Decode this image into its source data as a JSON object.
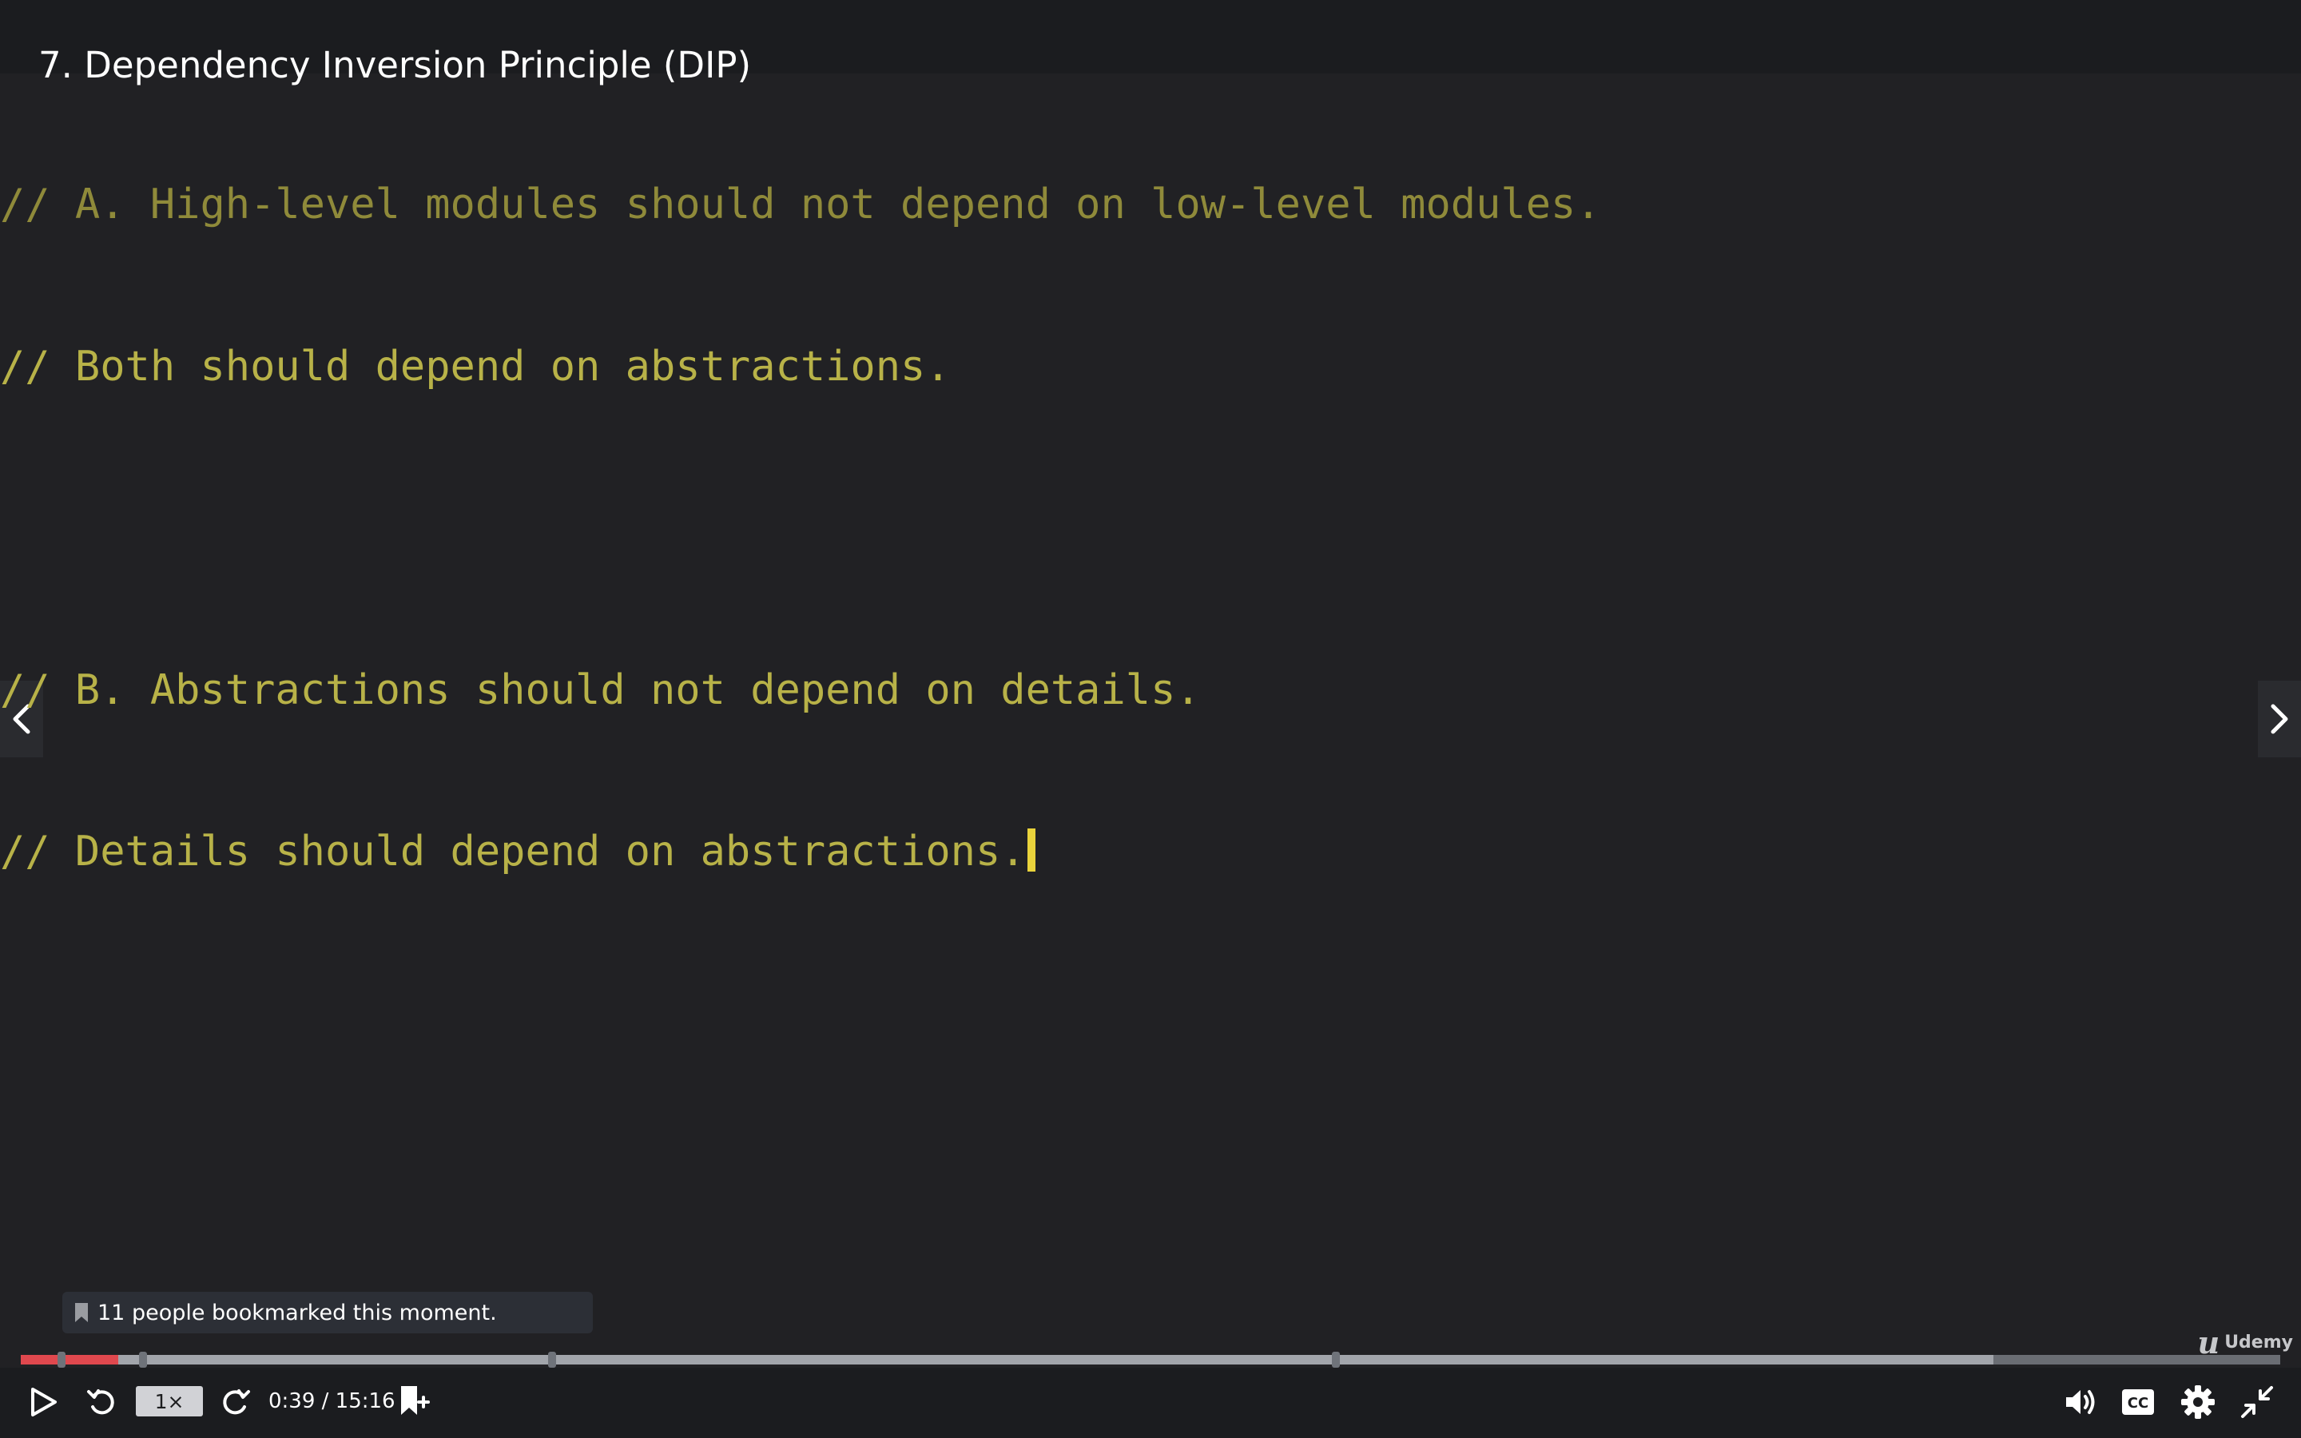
{
  "video": {
    "title": "7. Dependency Inversion Principle (DIP)"
  },
  "editor": {
    "lines": [
      "// A. High-level modules should not depend on low-level modules.",
      "// Both should depend on abstractions.",
      "",
      "// B. Abstractions should not depend on details.",
      "// Details should depend on abstractions."
    ]
  },
  "bookmark": {
    "text": "11 people bookmarked this moment."
  },
  "player": {
    "speed_label": "1×",
    "time_display": "0:39 / 15:16",
    "current_time": "0:39",
    "duration": "15:16",
    "played_fraction": 0.043,
    "buffered_fraction": 0.873,
    "bookmark_positions": [
      0.018,
      0.054,
      0.235,
      0.582
    ],
    "played_color": "#e0484e",
    "brand_name": "Udemy"
  },
  "icons": {
    "prev": "chevron-left-icon",
    "next": "chevron-right-icon",
    "play": "play-icon",
    "rewind": "rewind-icon",
    "forward": "forward-icon",
    "add_bookmark": "add-bookmark-icon",
    "volume": "volume-icon",
    "captions": "captions-icon",
    "settings": "gear-icon",
    "exit_fullscreen": "exit-fullscreen-icon"
  }
}
